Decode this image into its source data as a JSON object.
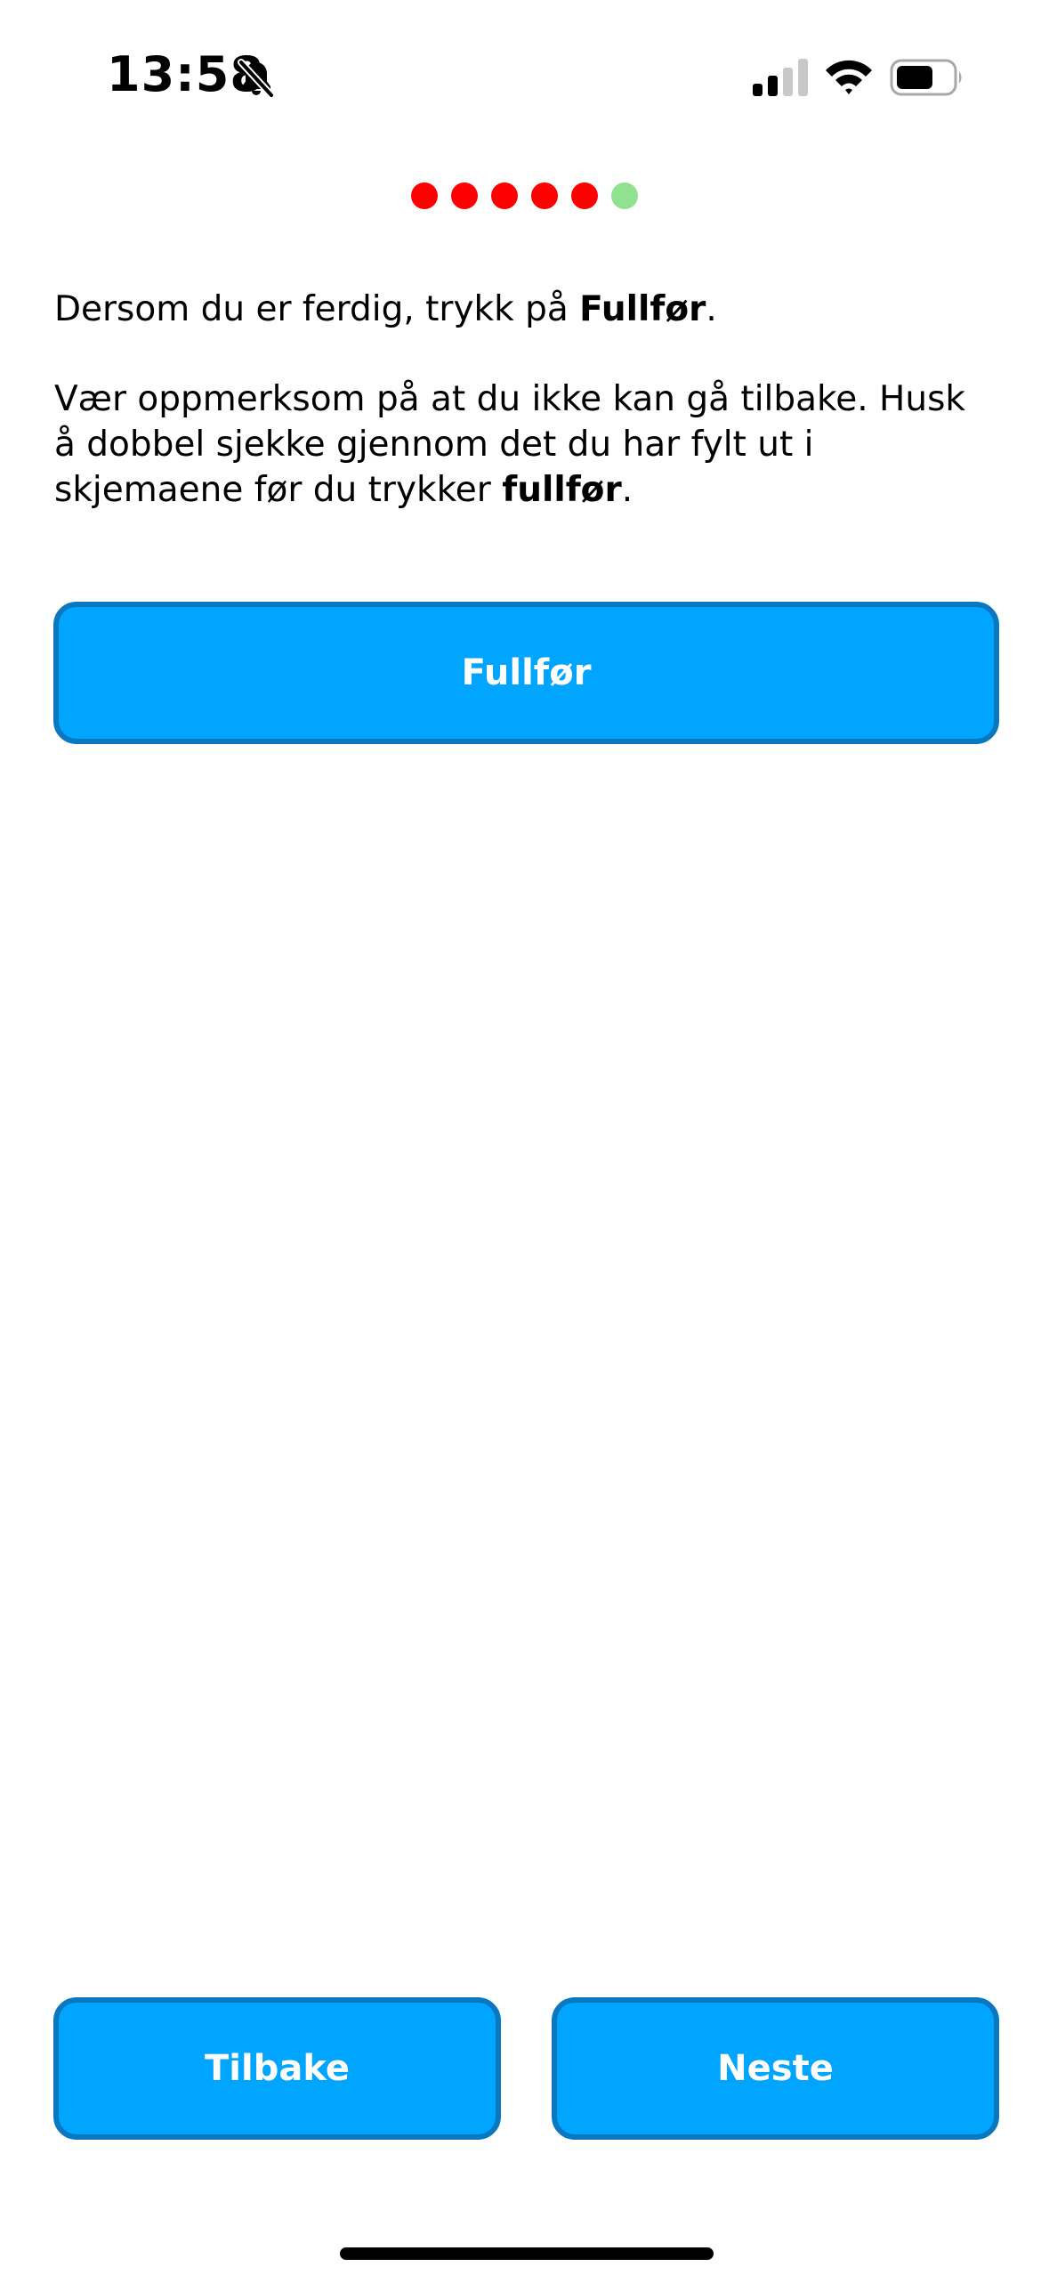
{
  "status_bar": {
    "time": "13:58",
    "icons": [
      "bell-slash-icon",
      "cellular-signal-icon",
      "wifi-icon",
      "battery-icon"
    ]
  },
  "progress": {
    "total_steps": 6,
    "current_step": 6,
    "colors": {
      "completed": "#ff0000",
      "current": "#90e28f"
    }
  },
  "content": {
    "paragraph1": {
      "text": "Dersom du er ferdig, trykk på ",
      "bold": "Fullfør",
      "end": "."
    },
    "paragraph2": {
      "text": "Vær oppmerksom på at du ikke kan gå tilbake. Husk å dobbel sjekke gjennom det du har fylt ut i skjemaene før du trykker ",
      "bold": "fullfør",
      "end": "."
    }
  },
  "buttons": {
    "finish_label": "Fullfør",
    "back_label": "Tilbake",
    "next_label": "Neste"
  },
  "colors": {
    "button_fill": "#00a5ff",
    "button_border": "#0a78c0",
    "button_text": "#ffffff"
  }
}
